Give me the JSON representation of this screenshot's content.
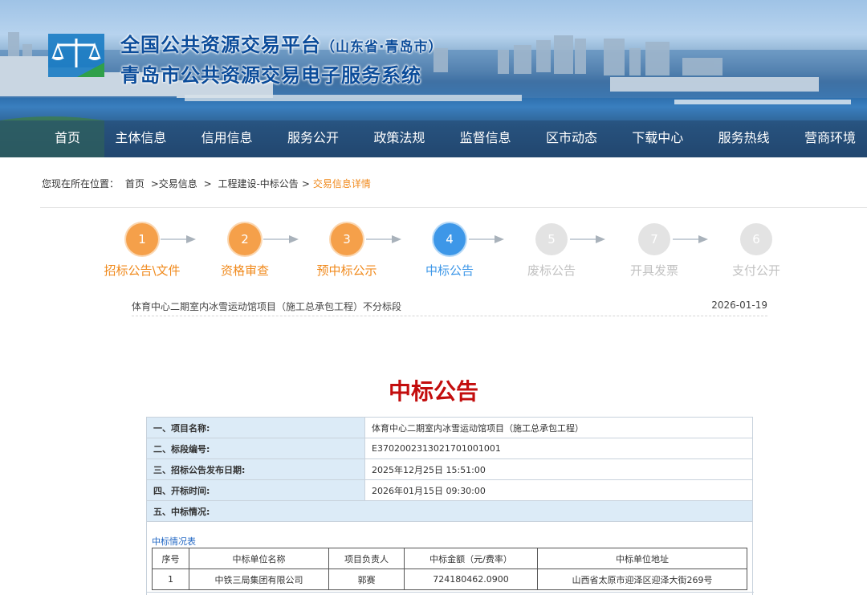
{
  "header": {
    "title_line1": "全国公共资源交易平台",
    "title_line1_sub": "（山东省·青岛市）",
    "title_line2": "青岛市公共资源交易电子服务系统",
    "logo_icon": "scales-of-justice-logo"
  },
  "nav": {
    "items": [
      "首页",
      "主体信息",
      "信用信息",
      "服务公开",
      "政策法规",
      "监督信息",
      "区市动态",
      "下载中心",
      "服务热线",
      "营商环境"
    ]
  },
  "breadcrumb": {
    "prefix": "您现在所在位置：",
    "items": [
      "首页",
      ">交易信息",
      ">",
      "工程建设-中标公告",
      ">"
    ],
    "current": "交易信息详情"
  },
  "steps": [
    {
      "num": "1",
      "label": "招标公告\\文件",
      "state": "done"
    },
    {
      "num": "2",
      "label": "资格审查",
      "state": "done"
    },
    {
      "num": "3",
      "label": "预中标公示",
      "state": "done"
    },
    {
      "num": "4",
      "label": "中标公告",
      "state": "active"
    },
    {
      "num": "5",
      "label": "废标公告",
      "state": "todo"
    },
    {
      "num": "7",
      "label": "开具发票",
      "state": "todo"
    },
    {
      "num": "6",
      "label": "支付公开",
      "state": "todo"
    }
  ],
  "colors": {
    "done": "#f5a04a",
    "active": "#3d97e8",
    "todo": "#e3e3e3",
    "notice_title": "#c30d0d",
    "nav_text": "#ffffff",
    "label_bg": "#dcebf7"
  },
  "project": {
    "title": "体育中心二期室内冰雪运动馆项目（施工总承包工程）不分标段",
    "date": "2026-01-19"
  },
  "notice": {
    "title": "中标公告",
    "rows": [
      {
        "label": "一、项目名称:",
        "value": "体育中心二期室内冰雪运动馆项目（施工总承包工程）"
      },
      {
        "label": "二、标段编号:",
        "value": "E3702002313021701001001"
      },
      {
        "label": "三、招标公告发布日期:",
        "value": "2025年12月25日 15:51:00"
      },
      {
        "label": "四、开标时间:",
        "value": "2026年01月15日 09:30:00"
      }
    ],
    "section5": "五、中标情况:",
    "sub_caption": "中标情况表",
    "bid_headers": [
      "序号",
      "中标单位名称",
      "项目负责人",
      "中标金额（元/费率）",
      "中标单位地址"
    ],
    "bid_rows": [
      [
        "1",
        "中铁三局集团有限公司",
        "郭赛",
        "724180462.0900",
        "山西省太原市迎泽区迎泽大街269号"
      ]
    ]
  }
}
